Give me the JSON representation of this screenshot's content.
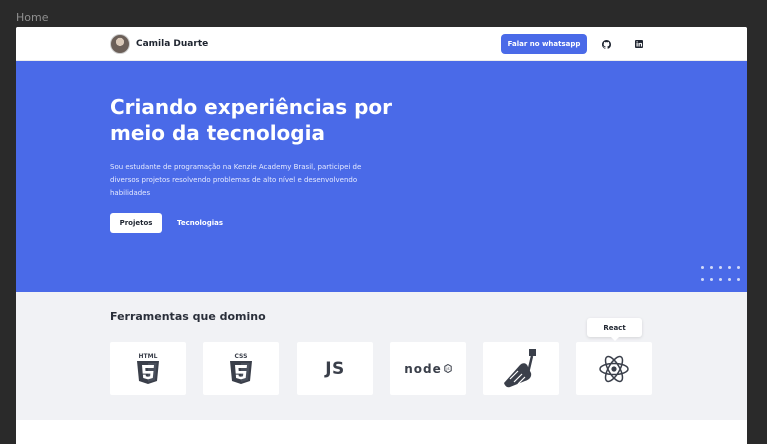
{
  "canvas": {
    "label": "Home"
  },
  "header": {
    "name": "Camila Duarte",
    "whatsapp_label": "Falar no whatsapp",
    "icons": [
      "github-icon",
      "linkedin-icon"
    ]
  },
  "hero": {
    "title": "Criando experiências por meio da tecnologia",
    "description": "Sou estudante de programação na Kenzie Academy Brasil, participei de diversos projetos resolvendo problemas de alto nível e desenvolvendo habilidades",
    "primary_button": "Projetos",
    "secondary_link": "Tecnologias"
  },
  "tools": {
    "title": "Ferramentas que domino",
    "tooltip": "React",
    "items": [
      {
        "name": "html5-icon",
        "label": "HTML"
      },
      {
        "name": "css3-icon",
        "label": "CSS"
      },
      {
        "name": "javascript-icon",
        "label": "JS"
      },
      {
        "name": "nodejs-icon",
        "label": "node"
      },
      {
        "name": "git-hand-icon"
      },
      {
        "name": "react-icon"
      }
    ]
  },
  "colors": {
    "accent": "#4a6ae8",
    "section_bg": "#f1f2f5",
    "icon_dark": "#3a3f4a"
  }
}
